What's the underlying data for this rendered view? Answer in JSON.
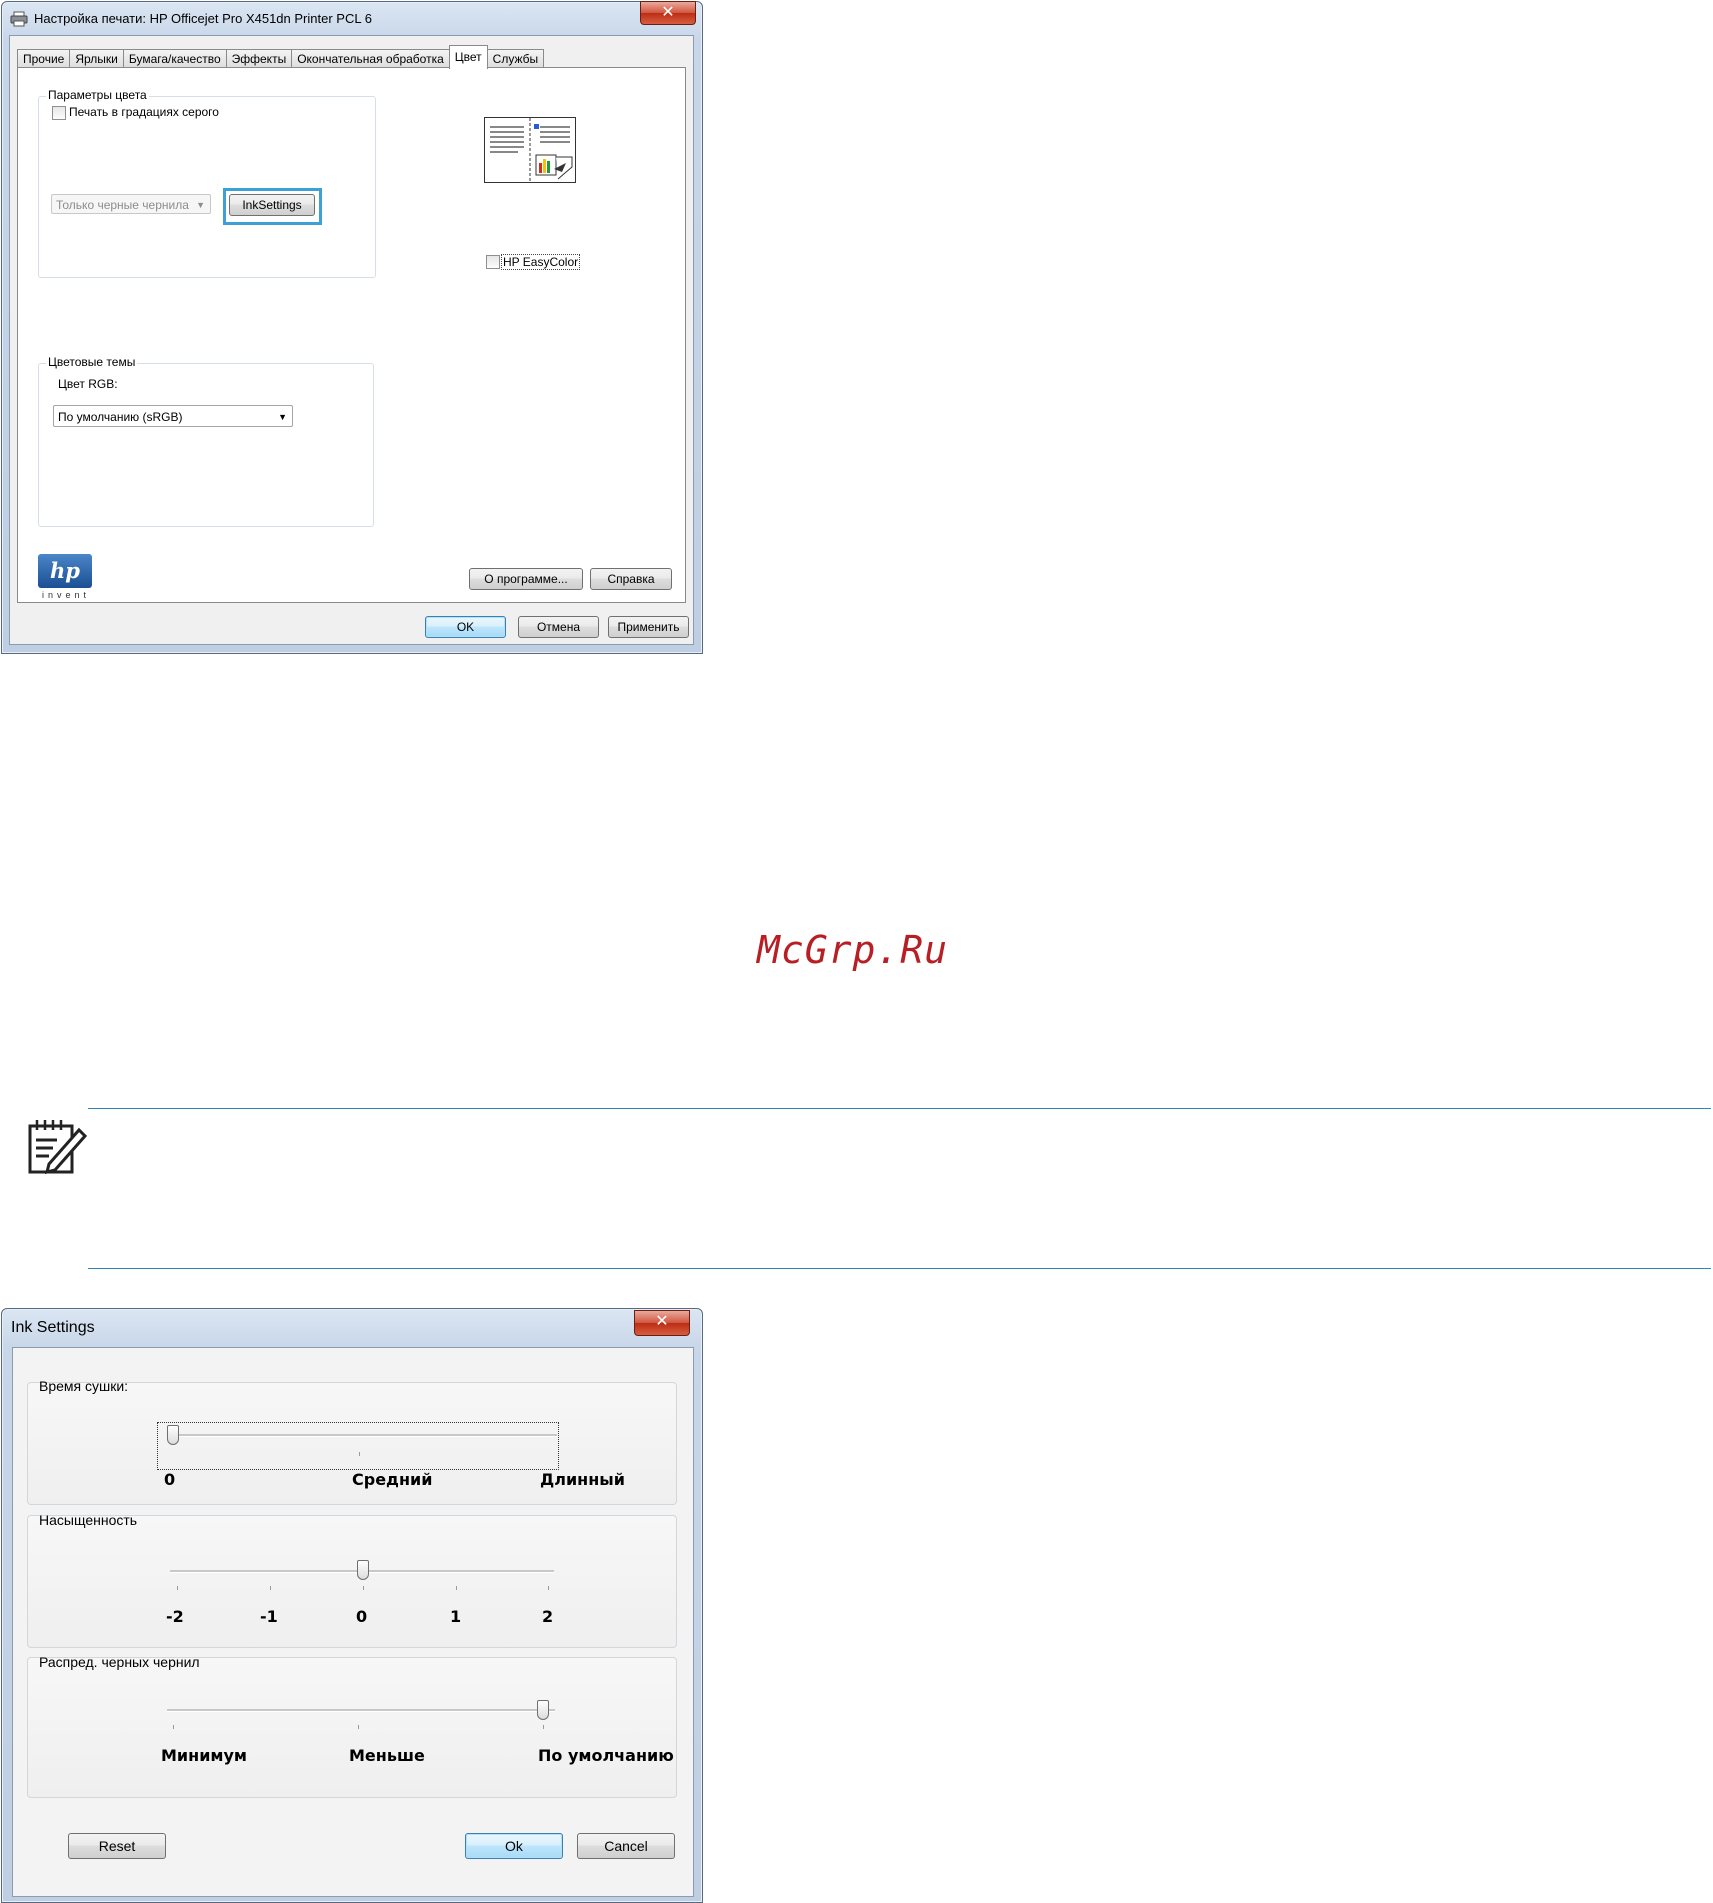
{
  "print_dialog": {
    "title": "Настройка печати: HP Officejet Pro X451dn Printer PCL 6",
    "close_glyph": "✕",
    "tabs": [
      {
        "label": "Прочие",
        "active": false
      },
      {
        "label": "Ярлыки",
        "active": false
      },
      {
        "label": "Бумага/качество",
        "active": false
      },
      {
        "label": "Эффекты",
        "active": false
      },
      {
        "label": "Окончательная обработка",
        "active": false
      },
      {
        "label": "Цвет",
        "active": true
      },
      {
        "label": "Службы",
        "active": false
      }
    ],
    "color_params": {
      "legend": "Параметры цвета",
      "grayscale_label": "Печать в градациях серого",
      "grayscale_checked": false,
      "ink_combo_value": "Только черные чернила",
      "ink_settings_button": "InkSettings"
    },
    "easycolor": {
      "label": "HP EasyColor",
      "checked": false
    },
    "color_themes": {
      "legend": "Цветовые темы",
      "rgb_label": "Цвет RGB:",
      "rgb_value": "По умолчанию (sRGB)"
    },
    "logo": {
      "mark": "hp",
      "tagline": "invent"
    },
    "about_button": "О программе...",
    "help_button": "Справка",
    "ok_button": "OK",
    "cancel_button": "Отмена",
    "apply_button": "Применить"
  },
  "watermark": "McGrp.Ru",
  "note_icon": "notepad-pencil-icon",
  "ink_dialog": {
    "title": "Ink Settings",
    "close_glyph": "✕",
    "drying": {
      "legend": "Время сушки:",
      "value_index": 0,
      "labels": [
        "0",
        "Средний",
        "Длинный"
      ]
    },
    "saturation": {
      "legend": "Насыщенность",
      "value": 0,
      "labels": [
        "-2",
        "-1",
        "0",
        "1",
        "2"
      ]
    },
    "black_spread": {
      "legend": "Распред. черных чернил",
      "value_index": 2,
      "labels": [
        "Минимум",
        "Меньше",
        "По умолчанию"
      ]
    },
    "reset_button": "Reset",
    "ok_button": "Ok",
    "cancel_button": "Cancel"
  },
  "colors": {
    "accent_blue": "#3da0d6",
    "note_line": "#2e86c1",
    "watermark_red": "#b71f24",
    "close_red": "#c8381c"
  }
}
